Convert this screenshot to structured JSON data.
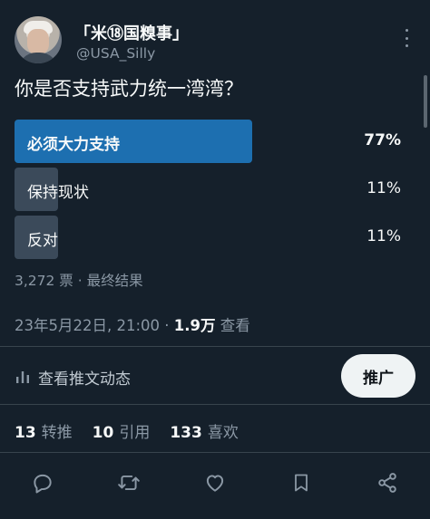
{
  "author": {
    "display_name": "「米⑱国糗事」",
    "handle": "@USA_Silly"
  },
  "tweet": {
    "text": "你是否支持武力统一湾湾？"
  },
  "poll": {
    "options": [
      {
        "label": "必须大力支持",
        "percent": 77,
        "percent_text": "77%",
        "winner": true
      },
      {
        "label": "保持现状",
        "percent": 11,
        "percent_text": "11%",
        "winner": false
      },
      {
        "label": "反对",
        "percent": 11,
        "percent_text": "11%",
        "winner": false
      }
    ],
    "meta": "3,272 票 · 最终结果"
  },
  "timestamp": {
    "date": "23年5月22日, 21:00 · ",
    "views_count": "1.9万",
    "views_label": " 查看"
  },
  "analytics": {
    "label": "查看推文动态"
  },
  "promote": {
    "label": "推广"
  },
  "stats": {
    "retweets": {
      "count": "13",
      "label": "转推"
    },
    "quotes": {
      "count": "10",
      "label": "引用"
    },
    "likes": {
      "count": "133",
      "label": "喜欢"
    }
  },
  "colors": {
    "background": "#15202b",
    "winner_bar": "#1d6fb0",
    "other_bar": "#3b4a5a",
    "muted_text": "#8b98a5",
    "promote_button": "#eff3f4"
  },
  "icons": {
    "actions": [
      "reply-icon",
      "retweet-icon",
      "like-icon",
      "bookmark-icon",
      "share-icon"
    ]
  }
}
